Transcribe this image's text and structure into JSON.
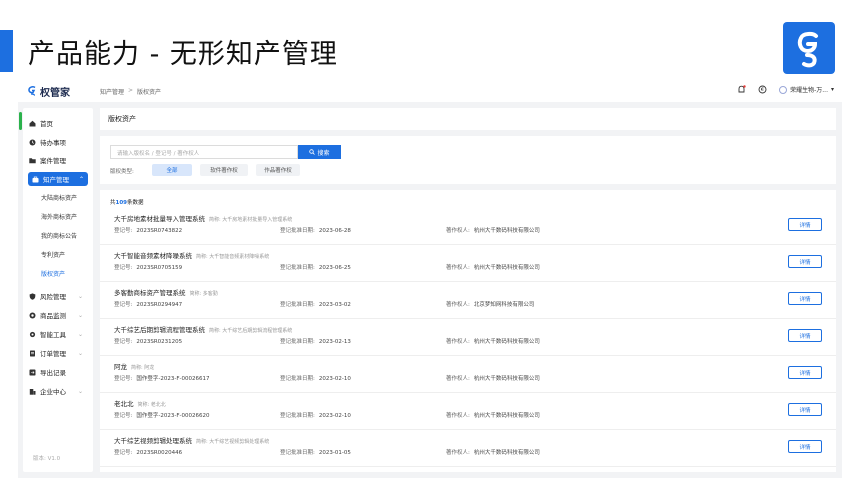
{
  "slide": {
    "title": "产品能力 - 无形知产管理",
    "accent_color": "#1d6fe0"
  },
  "app": {
    "name": "权管家",
    "breadcrumb": [
      "知产管理",
      "版权资产"
    ],
    "user": "荣耀生物-万...",
    "version": "版本: V1.0"
  },
  "sidebar": {
    "items": [
      {
        "label": "首页",
        "icon": "home-icon"
      },
      {
        "label": "待办事项",
        "icon": "clock-icon"
      },
      {
        "label": "案件管理",
        "icon": "folder-icon"
      },
      {
        "label": "知产管理",
        "icon": "bag-icon",
        "active": true
      },
      {
        "label": "风险管理",
        "icon": "shield-icon"
      },
      {
        "label": "商品监测",
        "icon": "monitor-icon"
      },
      {
        "label": "智能工具",
        "icon": "gear-icon"
      },
      {
        "label": "订单管理",
        "icon": "order-icon"
      },
      {
        "label": "导出记录",
        "icon": "export-icon"
      },
      {
        "label": "企业中心",
        "icon": "building-icon"
      }
    ],
    "sub_items": [
      "大陆商标资产",
      "海外商标资产",
      "我的商标公告",
      "专利资产",
      "版权资产"
    ]
  },
  "page": {
    "title": "版权资产",
    "search_placeholder": "请输入版权名 / 登记号 / 著作权人",
    "search_button": "搜索",
    "filter_label": "版权类型:",
    "filters": [
      "全部",
      "软件著作权",
      "作品著作权"
    ],
    "total_prefix": "共",
    "total_count": "109",
    "total_suffix": "条数据",
    "labels": {
      "reg_no": "登记号:",
      "date": "登记批准日期:",
      "owner": "著作权人:",
      "detail": "详情"
    }
  },
  "records": [
    {
      "name": "大千房地素材批量导入管理系统",
      "alias": "简称: 大千房地素材批量导入管理系统",
      "reg_no": "2023SR0743822",
      "date": "2023-06-28",
      "owner": "杭州大千数码科技有限公司"
    },
    {
      "name": "大千智能音频素材降噪系统",
      "alias": "简称: 大千智能音频素材降噪系统",
      "reg_no": "2023SR0705159",
      "date": "2023-06-25",
      "owner": "杭州大千数码科技有限公司"
    },
    {
      "name": "多客勤商标资产管理系统",
      "alias": "简称: 多客勤",
      "reg_no": "2023SR0294947",
      "date": "2023-03-02",
      "owner": "北京梦知网科技有限公司"
    },
    {
      "name": "大千综艺后期剪辑流程管理系统",
      "alias": "简称: 大千综艺后期剪辑流程管理系统",
      "reg_no": "2023SR0231205",
      "date": "2023-02-13",
      "owner": "杭州大千数码科技有限公司"
    },
    {
      "name": "阿龙",
      "alias": "简称: 阿龙",
      "reg_no": "国作登字-2023-F-00026617",
      "date": "2023-02-10",
      "owner": "杭州大千数码科技有限公司"
    },
    {
      "name": "老北北",
      "alias": "简称: 老北北",
      "reg_no": "国作登字-2023-F-00026620",
      "date": "2023-02-10",
      "owner": "杭州大千数码科技有限公司"
    },
    {
      "name": "大千综艺视频剪辑处理系统",
      "alias": "简称: 大千综艺视频剪辑处理系统",
      "reg_no": "2023SR0020446",
      "date": "2023-01-05",
      "owner": "杭州大千数码科技有限公司"
    }
  ]
}
